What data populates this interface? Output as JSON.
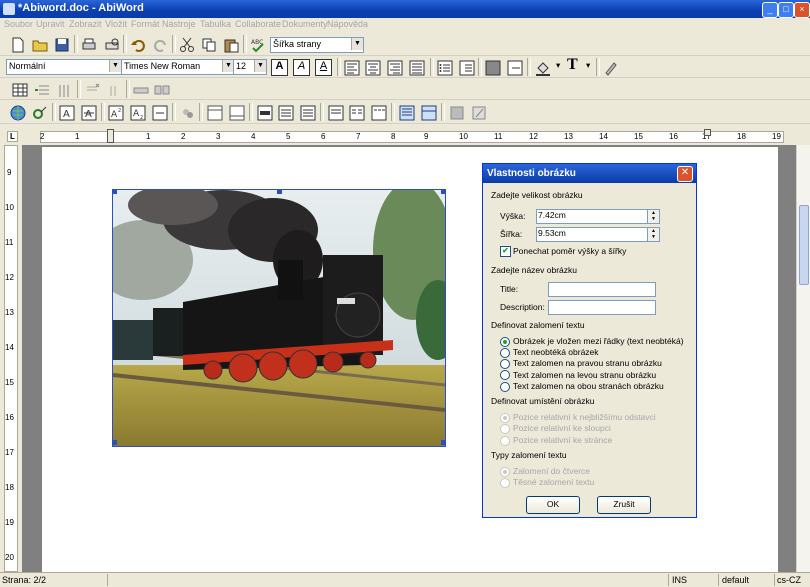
{
  "window": {
    "title": "*Abiword.doc - AbiWord"
  },
  "menu": [
    "Soubor",
    "Upravit",
    "Zobrazit",
    "Vložit",
    "Formát",
    "Nástroje",
    "Tabulka",
    "Collaborate",
    "Dokumenty",
    "Nápověda"
  ],
  "toolbar": {
    "zoom": "Šířka strany",
    "style": "Normální",
    "font": "Times New Roman",
    "size": "12",
    "bold_glyph": "A",
    "italic_glyph": "A",
    "underline_glyph": "A",
    "text_glyph": "T"
  },
  "ruler": {
    "h_ticks": [
      "2",
      "1",
      "1",
      "2",
      "3",
      "4",
      "5",
      "6",
      "7",
      "8",
      "9",
      "10",
      "11",
      "12",
      "13",
      "14",
      "15",
      "16",
      "17",
      "18",
      "19"
    ],
    "v_ticks": [
      "9",
      "10",
      "11",
      "12",
      "13",
      "14",
      "15",
      "16",
      "17",
      "18",
      "19",
      "20"
    ],
    "corner": "L"
  },
  "statusbar": {
    "page": "Strana: 2/2",
    "mode": "INS",
    "lang_default": "default",
    "locale": "cs-CZ"
  },
  "dialog": {
    "title": "Vlastnosti obrázku",
    "size_section": "Zadejte velikost obrázku",
    "height_label": "Výška:",
    "height_value": "7.42cm",
    "width_label": "Šířka:",
    "width_value": "9.53cm",
    "keep_ratio": "Ponechat poměr výšky a šířky",
    "name_section": "Zadejte název obrázku",
    "title_label": "Title:",
    "title_value": "",
    "desc_label": "Description:",
    "desc_value": "",
    "wrap_section": "Definovat zalomení textu",
    "wrap_options": [
      "Obrázek je vložen mezi řádky (text neobtéká)",
      "Text neobtéká obrázek",
      "Text zalomen na pravou stranu obrázku",
      "Text zalomen na levou stranu obrázku",
      "Text zalomen na obou stranách obrázku"
    ],
    "pos_section": "Definovat umístění obrázku",
    "pos_options": [
      "Pozice relativní k nejbližšímu odstavci",
      "Pozice relativní ke sloupci",
      "Pozice relativní ke stránce"
    ],
    "type_section": "Typy zalomení textu",
    "type_options": [
      "Zalomení do čtverce",
      "Těsné zalomení textu"
    ],
    "ok": "OK",
    "cancel": "Zrušit"
  },
  "colors": {
    "accent": "#0b3ba8",
    "selection": "#2a4fc0"
  }
}
